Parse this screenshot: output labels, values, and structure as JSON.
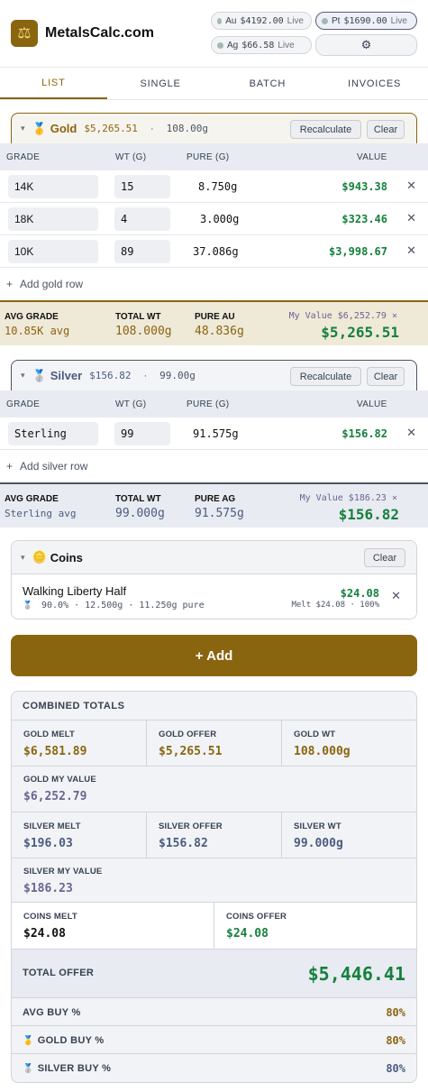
{
  "header": {
    "brand": "MetalsCalc.com",
    "logo_icon": "balance-scale-icon",
    "prices": {
      "au": {
        "symbol": "Au",
        "price": "$4192.00",
        "status": "Live"
      },
      "pt": {
        "symbol": "Pt",
        "price": "$1690.00",
        "status": "Live"
      },
      "ag": {
        "symbol": "Ag",
        "price": "$66.58",
        "status": "Live"
      }
    },
    "settings_icon": "gear-icon"
  },
  "tabs": [
    {
      "label": "LIST",
      "active": true
    },
    {
      "label": "SINGLE",
      "active": false
    },
    {
      "label": "BATCH",
      "active": false
    },
    {
      "label": "INVOICES",
      "active": false
    }
  ],
  "gold": {
    "name": "Gold",
    "value": "$5,265.51",
    "separator": "·",
    "weight": "108.00g",
    "recalc_label": "Recalculate",
    "clear_label": "Clear",
    "columns": {
      "grade": "GRADE",
      "wt": "WT (G)",
      "pure": "PURE (G)",
      "value": "VALUE"
    },
    "rows": [
      {
        "grade": "14K",
        "wt": "15",
        "pure": "8.750g",
        "value": "$943.38"
      },
      {
        "grade": "18K",
        "wt": "4",
        "pure": "3.000g",
        "value": "$323.46"
      },
      {
        "grade": "10K",
        "wt": "89",
        "pure": "37.086g",
        "value": "$3,998.67"
      }
    ],
    "add_row": "Add gold row",
    "summary": {
      "avg_label": "AVG GRADE",
      "avg_value": "10.85K avg",
      "total_label": "TOTAL WT",
      "total_value": "108.000g",
      "pure_label": "PURE AU",
      "pure_value": "48.836g",
      "my_value": "My Value $6,252.79 ×",
      "offer": "$5,265.51"
    }
  },
  "silver": {
    "name": "Silver",
    "value": "$156.82",
    "separator": "·",
    "weight": "99.00g",
    "recalc_label": "Recalculate",
    "clear_label": "Clear",
    "columns": {
      "grade": "GRADE",
      "wt": "WT (G)",
      "pure": "PURE (G)",
      "value": "VALUE"
    },
    "rows": [
      {
        "grade": "Sterling",
        "wt": "99",
        "pure": "91.575g",
        "value": "$156.82"
      }
    ],
    "add_row": "Add silver row",
    "summary": {
      "avg_label": "AVG GRADE",
      "avg_value": "Sterling avg",
      "total_label": "TOTAL WT",
      "total_value": "99.000g",
      "pure_label": "PURE AG",
      "pure_value": "91.575g",
      "my_value": "My Value $186.23 ×",
      "offer": "$156.82"
    }
  },
  "coins": {
    "name": "Coins",
    "clear_label": "Clear",
    "items": [
      {
        "name": "Walking Liberty Half",
        "details": "90.0% · 12.500g · 11.250g pure",
        "value": "$24.08",
        "melt": "Melt $24.08 · 100%"
      }
    ]
  },
  "add_button": "+ Add",
  "totals": {
    "title": "COMBINED TOTALS",
    "gold_melt_label": "GOLD MELT",
    "gold_melt": "$6,581.89",
    "gold_offer_label": "GOLD OFFER",
    "gold_offer": "$5,265.51",
    "gold_wt_label": "GOLD WT",
    "gold_wt": "108.000g",
    "gold_my_label": "GOLD MY VALUE",
    "gold_my": "$6,252.79",
    "silver_melt_label": "SILVER MELT",
    "silver_melt": "$196.03",
    "silver_offer_label": "SILVER OFFER",
    "silver_offer": "$156.82",
    "silver_wt_label": "SILVER WT",
    "silver_wt": "99.000g",
    "silver_my_label": "SILVER MY VALUE",
    "silver_my": "$186.23",
    "coins_melt_label": "COINS MELT",
    "coins_melt": "$24.08",
    "coins_offer_label": "COINS OFFER",
    "coins_offer": "$24.08",
    "total_offer_label": "TOTAL OFFER",
    "total_offer": "$5,446.41",
    "avg_buy_label": "AVG BUY %",
    "avg_buy": "80%",
    "gold_buy_label": "GOLD BUY %",
    "gold_buy": "80%",
    "silver_buy_label": "SILVER BUY %",
    "silver_buy": "80%"
  },
  "colors": {
    "gold": "#8a6510",
    "silver": "#4b5b80",
    "green": "#15803d",
    "purple": "#6b6490"
  }
}
